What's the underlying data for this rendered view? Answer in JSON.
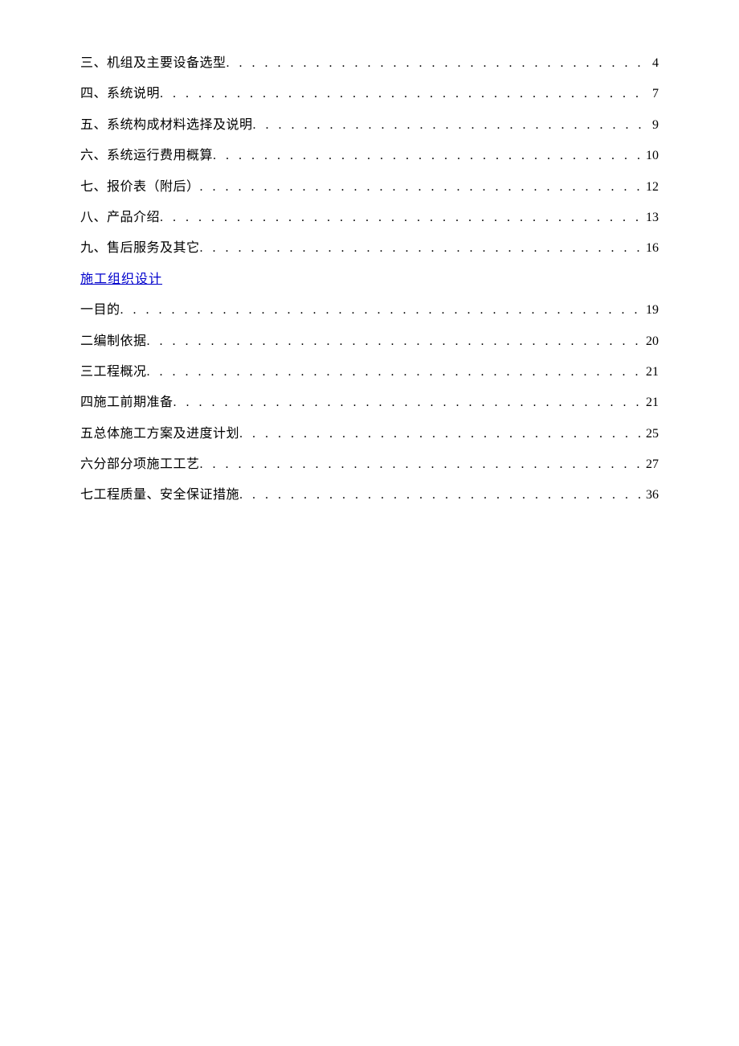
{
  "toc_group1": [
    {
      "title": "三、机组及主要设备选型",
      "page": "4"
    },
    {
      "title": "四、系统说明",
      "page": "7"
    },
    {
      "title": "五、系统构成材料选择及说明",
      "page": "9"
    },
    {
      "title": "六、系统运行费用概算",
      "page": "10"
    },
    {
      "title": "七、报价表（附后）",
      "page": "12"
    },
    {
      "title": "八、产品介绍",
      "page": "13"
    },
    {
      "title": "九、售后服务及其它",
      "page": "16"
    }
  ],
  "section_link": "施工组织设计",
  "toc_group2": [
    {
      "title": "一目的",
      "page": "19"
    },
    {
      "title": "二编制依据",
      "page": "20"
    },
    {
      "title": "三工程概况",
      "page": "21"
    },
    {
      "title": "四施工前期准备",
      "page": "21"
    },
    {
      "title": "五总体施工方案及进度计划",
      "page": "25"
    },
    {
      "title": "六分部分项施工工艺",
      "page": "27"
    },
    {
      "title": "七工程质量、安全保证措施",
      "page": "36"
    }
  ]
}
